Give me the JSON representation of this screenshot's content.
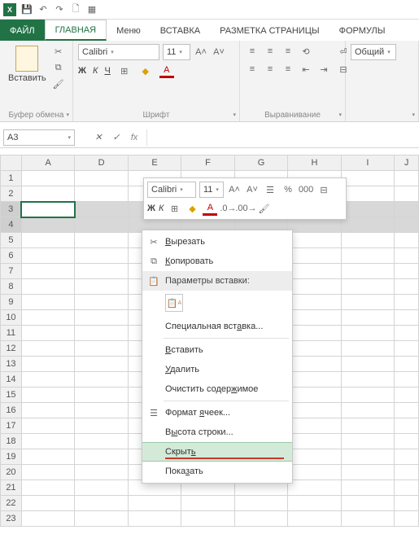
{
  "qat": {
    "save": "💾",
    "undo": "↶",
    "redo": "↷",
    "new": "🗋",
    "table": "▦"
  },
  "tabs": {
    "file": "ФАЙЛ",
    "home": "ГЛАВНАЯ",
    "menu": "Меню",
    "insert": "ВСТАВКА",
    "pagelayout": "РАЗМЕТКА СТРАНИЦЫ",
    "formulas": "ФОРМУЛЫ"
  },
  "ribbon": {
    "clipboard": {
      "paste": "Вставить",
      "label": "Буфер обмена"
    },
    "font": {
      "name_value": "Calibri",
      "size_value": "11",
      "label": "Шрифт",
      "bold": "Ж",
      "italic": "К",
      "underline": "Ч"
    },
    "alignment": {
      "label": "Выравнивание"
    },
    "number": {
      "format_value": "Общий"
    }
  },
  "formula_bar": {
    "name_box": "A3"
  },
  "columns": [
    "A",
    "D",
    "E",
    "F",
    "G",
    "H",
    "I",
    "J"
  ],
  "rows": [
    "1",
    "2",
    "3",
    "4",
    "5",
    "6",
    "7",
    "8",
    "9",
    "10",
    "11",
    "12",
    "13",
    "14",
    "15",
    "16",
    "17",
    "18",
    "19",
    "20",
    "21",
    "22",
    "23"
  ],
  "mini_toolbar": {
    "font": "Calibri",
    "size": "11",
    "percent": "%",
    "thousands": "000"
  },
  "context_menu": {
    "cut": "Вырезать",
    "copy": "Копировать",
    "paste_options": "Параметры вставки:",
    "paste_special": "Специальная вставка...",
    "insert": "Вставить",
    "delete": "Удалить",
    "clear": "Очистить содержимое",
    "format_cells": "Формат ячеек...",
    "row_height": "Высота строки...",
    "hide": "Скрыть",
    "unhide": "Показать"
  }
}
